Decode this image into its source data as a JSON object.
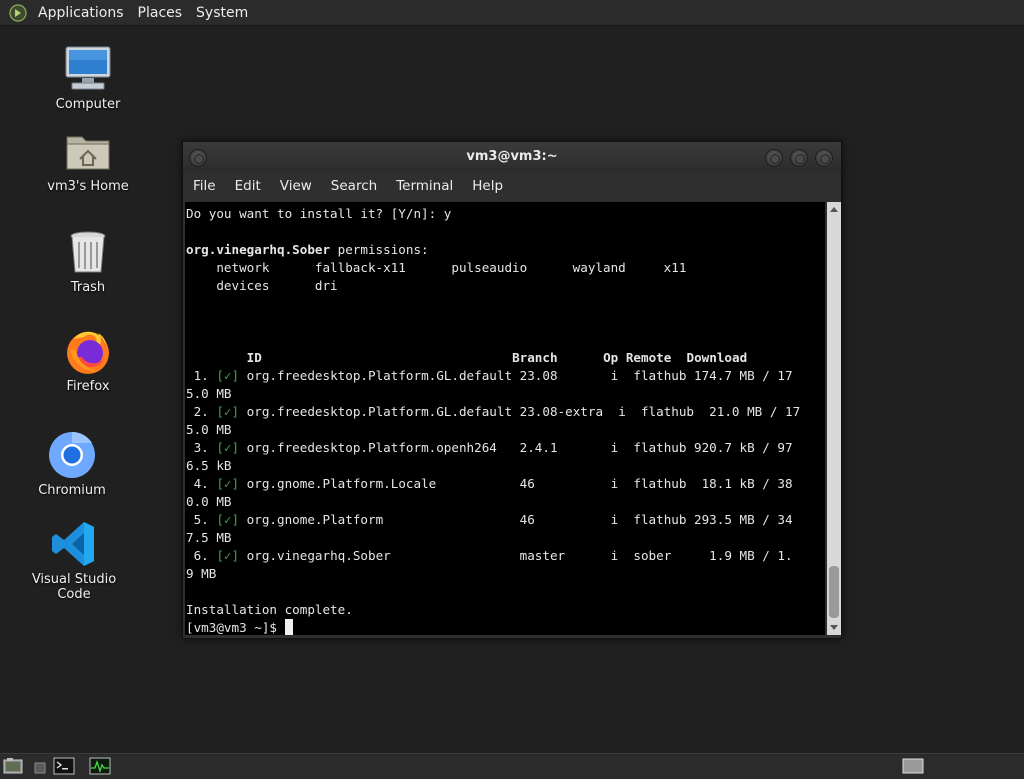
{
  "top_panel": {
    "menus": [
      "Applications",
      "Places",
      "System"
    ]
  },
  "desktop": {
    "icons": [
      {
        "label": "Computer",
        "icon": "computer-icon"
      },
      {
        "label": "vm3's Home",
        "icon": "home-folder-icon"
      },
      {
        "label": "Trash",
        "icon": "trash-icon"
      },
      {
        "label": "Firefox",
        "icon": "firefox-icon"
      },
      {
        "label": "Chromium",
        "icon": "chromium-icon"
      },
      {
        "label": "Visual Studio Code",
        "icon": "vscode-icon"
      }
    ]
  },
  "window": {
    "title": "vm3@vm3:~",
    "menus": [
      "File",
      "Edit",
      "View",
      "Search",
      "Terminal",
      "Help"
    ]
  },
  "terminal": {
    "prompt_question": "Do you want to install it? [Y/n]: y",
    "app_id": "org.vinegarhq.Sober",
    "permissions_suffix": " permissions:",
    "permissions_row1": "    network      fallback-x11      pulseaudio      wayland     x11",
    "permissions_row2": "    devices      dri",
    "table_header": {
      "id": "ID",
      "branch": "Branch",
      "op": "Op",
      "remote": "Remote",
      "download": "Download"
    },
    "rows": [
      {
        "num": " 1. ",
        "check": "[✓]",
        "rest": " org.freedesktop.Platform.GL.default 23.08       i  flathub 174.7 MB / 17",
        "wrap": "5.0 MB"
      },
      {
        "num": " 2. ",
        "check": "[✓]",
        "rest": " org.freedesktop.Platform.GL.default 23.08-extra  i  flathub  21.0 MB / 17",
        "wrap": "5.0 MB"
      },
      {
        "num": " 3. ",
        "check": "[✓]",
        "rest": " org.freedesktop.Platform.openh264   2.4.1       i  flathub 920.7 kB / 97",
        "wrap": "6.5 kB"
      },
      {
        "num": " 4. ",
        "check": "[✓]",
        "rest": " org.gnome.Platform.Locale           46          i  flathub  18.1 kB / 38",
        "wrap": "0.0 MB"
      },
      {
        "num": " 5. ",
        "check": "[✓]",
        "rest": " org.gnome.Platform                  46          i  flathub 293.5 MB / 34",
        "wrap": "7.5 MB"
      },
      {
        "num": " 6. ",
        "check": "[✓]",
        "rest": " org.vinegarhq.Sober                 master      i  sober     1.9 MB / 1.",
        "wrap": "9 MB"
      }
    ],
    "complete": "Installation complete.",
    "prompt": "[vm3@vm3 ~]$ "
  },
  "bottom_panel": {
    "items": [
      "show-desktop-icon",
      "terminal-launcher-icon",
      "system-monitor-icon",
      "workspace-switcher"
    ]
  },
  "colors": {
    "desktop_bg": "#202020",
    "panel_bg": "#2b2b2b",
    "terminal_bg": "#000000",
    "check_green": "#3aa63a",
    "vscode_blue": "#23a9f2"
  }
}
